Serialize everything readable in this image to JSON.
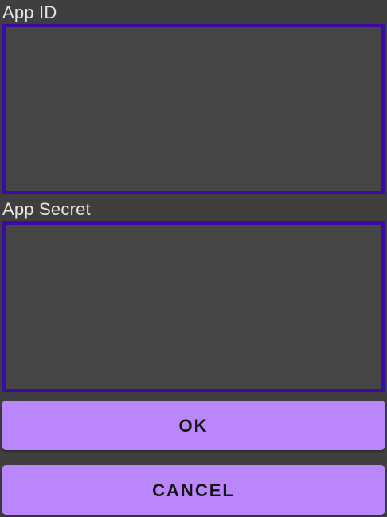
{
  "form": {
    "app_id": {
      "label": "App ID",
      "value": ""
    },
    "app_secret": {
      "label": "App Secret",
      "value": ""
    }
  },
  "actions": {
    "ok_label": "OK",
    "cancel_label": "CANCEL"
  },
  "colors": {
    "background": "#3f3f3f",
    "field_background": "#454545",
    "field_border": "#3a0ca3",
    "button_background": "#bb86fc",
    "button_text": "#141414",
    "label_text": "#e6e6e6"
  }
}
